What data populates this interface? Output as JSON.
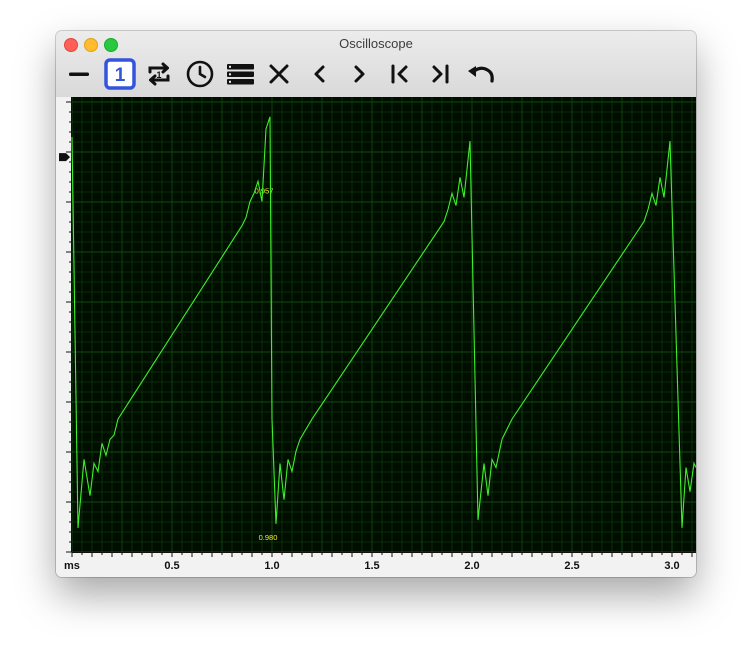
{
  "window": {
    "title": "Oscilloscope"
  },
  "toolbar": {
    "channel_number": "1",
    "buttons": [
      {
        "name": "minus-icon"
      },
      {
        "name": "channel-1-button"
      },
      {
        "name": "repeat-icon"
      },
      {
        "name": "clock-icon"
      },
      {
        "name": "list-icon"
      },
      {
        "name": "close-icon"
      },
      {
        "name": "chevron-left-icon"
      },
      {
        "name": "chevron-right-icon"
      },
      {
        "name": "skip-start-icon"
      },
      {
        "name": "skip-end-icon"
      },
      {
        "name": "undo-icon"
      }
    ]
  },
  "colors": {
    "grid_background": "#000e00",
    "grid_line": "#0f4a12",
    "trace": "#3ef028",
    "marker_label": "#f2f226",
    "channel_accent": "#3355dd"
  },
  "chart_data": {
    "type": "line",
    "xlabel": "ms",
    "x_tick_labels": [
      "0.5",
      "1.0",
      "1.5",
      "2.0",
      "2.5",
      "3.0"
    ],
    "x_ticks": [
      0.5,
      1.0,
      1.5,
      2.0,
      2.5,
      3.0
    ],
    "xlim": [
      0.0,
      3.12
    ],
    "ylim": [
      0,
      1
    ],
    "grid": true,
    "markers": [
      {
        "label": "0.957",
        "x": 0.96,
        "y": 0.86
      },
      {
        "label": "0.980",
        "x": 0.98,
        "y": 0.0
      }
    ],
    "series": [
      {
        "points": [
          [
            0.0,
            1.0
          ],
          [
            0.03,
            0.03
          ],
          [
            0.06,
            0.2
          ],
          [
            0.09,
            0.11
          ],
          [
            0.11,
            0.19
          ],
          [
            0.13,
            0.17
          ],
          [
            0.15,
            0.24
          ],
          [
            0.17,
            0.21
          ],
          [
            0.19,
            0.25
          ],
          [
            0.21,
            0.26
          ],
          [
            0.23,
            0.3
          ],
          [
            0.85,
            0.78
          ],
          [
            0.87,
            0.8
          ],
          [
            0.89,
            0.84
          ],
          [
            0.91,
            0.86
          ],
          [
            0.93,
            0.89
          ],
          [
            0.95,
            0.84
          ],
          [
            0.97,
            1.02
          ],
          [
            0.99,
            1.05
          ],
          [
            1.0,
            0.3
          ],
          [
            1.02,
            0.04
          ],
          [
            1.04,
            0.19
          ],
          [
            1.06,
            0.1
          ],
          [
            1.08,
            0.2
          ],
          [
            1.1,
            0.17
          ],
          [
            1.12,
            0.22
          ],
          [
            1.14,
            0.25
          ],
          [
            1.2,
            0.3
          ],
          [
            1.86,
            0.79
          ],
          [
            1.88,
            0.82
          ],
          [
            1.9,
            0.86
          ],
          [
            1.92,
            0.83
          ],
          [
            1.94,
            0.9
          ],
          [
            1.96,
            0.85
          ],
          [
            1.99,
            0.99
          ],
          [
            2.03,
            0.05
          ],
          [
            2.06,
            0.19
          ],
          [
            2.08,
            0.11
          ],
          [
            2.1,
            0.2
          ],
          [
            2.12,
            0.18
          ],
          [
            2.15,
            0.25
          ],
          [
            2.2,
            0.3
          ],
          [
            2.86,
            0.79
          ],
          [
            2.88,
            0.82
          ],
          [
            2.9,
            0.86
          ],
          [
            2.92,
            0.83
          ],
          [
            2.94,
            0.9
          ],
          [
            2.96,
            0.85
          ],
          [
            2.99,
            0.99
          ],
          [
            3.05,
            0.03
          ],
          [
            3.07,
            0.18
          ],
          [
            3.09,
            0.12
          ],
          [
            3.11,
            0.19
          ],
          [
            3.12,
            0.18
          ]
        ]
      }
    ]
  }
}
